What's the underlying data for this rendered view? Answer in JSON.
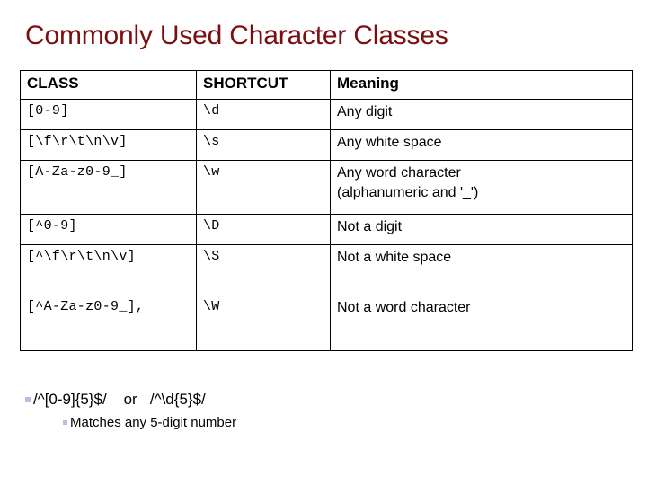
{
  "slide": {
    "title": "Commonly Used Character Classes",
    "title_color": "#7a0f12",
    "background_color": "#ffffff",
    "bullet_marker_color": "#b8bede"
  },
  "table": {
    "headers": {
      "class": "CLASS",
      "shortcut": "SHORTCUT",
      "meaning": "Meaning"
    },
    "rows": [
      {
        "class": "[0-9]",
        "shortcut": "\\d",
        "meaning": "Any digit"
      },
      {
        "class": "[\\f\\r\\t\\n\\v]",
        "shortcut": "\\s",
        "meaning": "Any white space"
      },
      {
        "class": "[A-Za-z0-9_]",
        "shortcut": "\\w",
        "meaning": "Any word character\n(alphanumeric and '_')"
      },
      {
        "class": "[^0-9]",
        "shortcut": "\\D",
        "meaning": "Not a digit"
      },
      {
        "class": "[^\\f\\r\\t\\n\\v]",
        "shortcut": "\\S",
        "meaning": "Not a white space"
      },
      {
        "class": "[^A-Za-z0-9_],",
        "shortcut": "\\W",
        "meaning": "Not a word character"
      }
    ]
  },
  "bullets": [
    {
      "level": 1,
      "text": "/^[0-9]{5}$/    or   /^\\d{5}$/"
    },
    {
      "level": 2,
      "text": "Matches any 5-digit number"
    }
  ]
}
